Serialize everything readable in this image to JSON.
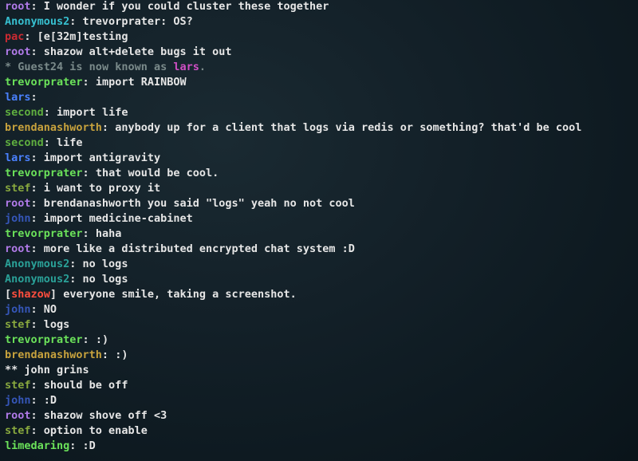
{
  "colon": ":",
  "bracket_open": "[",
  "bracket_close": "]",
  "star_prefix": " *",
  "ee_prefix": "** ",
  "lines": [
    {
      "kind": "msg",
      "user": "root",
      "color": "c-purple",
      "text": "I wonder if you could cluster these together"
    },
    {
      "kind": "msg",
      "user": "Anonymous2",
      "color": "c-cyan",
      "text": "trevorprater: OS?"
    },
    {
      "kind": "msg",
      "user": "pac",
      "color": "c-red",
      "text": "[e[32m]testing"
    },
    {
      "kind": "msg",
      "user": "root",
      "color": "c-purple",
      "text": "shazow alt+delete bugs it out"
    },
    {
      "kind": "nick",
      "prefix": "Guest24",
      "mid": " is now known as ",
      "new": "lars",
      "suffix": ".",
      "new_color": "c-magenta"
    },
    {
      "kind": "msg",
      "user": "trevorprater",
      "color": "c-green-br",
      "text": "import RAINBOW"
    },
    {
      "kind": "msg",
      "user": "lars",
      "color": "c-blue-br",
      "text": ""
    },
    {
      "kind": "msg",
      "user": "second",
      "color": "c-green",
      "text": "import life"
    },
    {
      "kind": "msg",
      "user": "brendanashworth",
      "color": "c-yellow",
      "text": "anybody up for a client that logs via redis or something? that'd be cool"
    },
    {
      "kind": "msg",
      "user": "second",
      "color": "c-green",
      "text": "life"
    },
    {
      "kind": "msg",
      "user": "lars",
      "color": "c-blue-br",
      "text": "import antigravity"
    },
    {
      "kind": "msg",
      "user": "trevorprater",
      "color": "c-green-br",
      "text": "that would be cool."
    },
    {
      "kind": "msg",
      "user": "stef",
      "color": "c-olive",
      "text": "i want to proxy it"
    },
    {
      "kind": "msg",
      "user": "root",
      "color": "c-purple",
      "text": "brendanashworth you said \"logs\" yeah no not cool"
    },
    {
      "kind": "msg",
      "user": "john",
      "color": "c-navy",
      "text": "import medicine-cabinet"
    },
    {
      "kind": "msg",
      "user": "trevorprater",
      "color": "c-green-br",
      "text": "haha"
    },
    {
      "kind": "msg",
      "user": "root",
      "color": "c-purple",
      "text": "more like a distributed encrypted chat system :D"
    },
    {
      "kind": "msg",
      "user": "Anonymous2",
      "color": "c-teal",
      "text": "no logs"
    },
    {
      "kind": "msg",
      "user": "Anonymous2",
      "color": "c-teal",
      "text": "no logs"
    },
    {
      "kind": "bracket",
      "user": "shazow",
      "color": "c-red-br",
      "text": "everyone smile, taking a screenshot."
    },
    {
      "kind": "msg",
      "user": "john",
      "color": "c-navy",
      "text": "NO"
    },
    {
      "kind": "msg",
      "user": "stef",
      "color": "c-olive",
      "text": "logs"
    },
    {
      "kind": "msg",
      "user": "trevorprater",
      "color": "c-green-br",
      "text": ":)"
    },
    {
      "kind": "msg",
      "user": "brendanashworth",
      "color": "c-yellow",
      "text": ":)"
    },
    {
      "kind": "emote",
      "user": "john",
      "color": "c-white",
      "text": "grins"
    },
    {
      "kind": "msg",
      "user": "stef",
      "color": "c-olive",
      "text": "should be off"
    },
    {
      "kind": "msg",
      "user": "john",
      "color": "c-navy",
      "text": ":D"
    },
    {
      "kind": "msg",
      "user": "root",
      "color": "c-purple",
      "text": "shazow shove off <3"
    },
    {
      "kind": "msg",
      "user": "stef",
      "color": "c-olive",
      "text": "option to enable"
    },
    {
      "kind": "msg",
      "user": "limedaring",
      "color": "c-green-br",
      "text": ":D"
    }
  ]
}
